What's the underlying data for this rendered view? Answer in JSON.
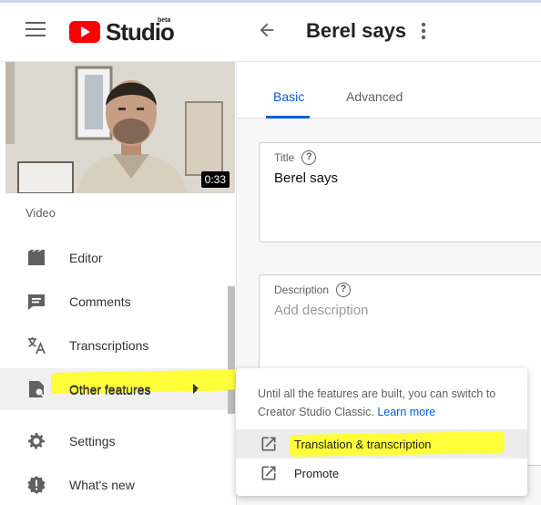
{
  "header": {
    "logo_text": "Studio",
    "logo_badge": "beta",
    "page_title": "Berel says",
    "icons": [
      "menu-icon",
      "youtube-play-icon",
      "back-arrow-icon",
      "more-vert-icon"
    ]
  },
  "sidebar": {
    "video_duration": "0:33",
    "section_label": "Video",
    "items": [
      {
        "label": "Editor",
        "icon": "film-icon"
      },
      {
        "label": "Comments",
        "icon": "comments-icon"
      },
      {
        "label": "Transcriptions",
        "icon": "translate-icon"
      },
      {
        "label": "Other features",
        "icon": "other-features-icon"
      },
      {
        "label": "Settings",
        "icon": "gear-icon"
      },
      {
        "label": "What's new",
        "icon": "whats-new-icon"
      }
    ]
  },
  "tabs": [
    {
      "label": "Basic"
    },
    {
      "label": "Advanced"
    }
  ],
  "form": {
    "title_label": "Title",
    "title_value": "Berel says",
    "description_label": "Description",
    "description_placeholder": "Add description"
  },
  "popup": {
    "text": "Until all the features are built, you can switch to Creator Studio Classic.",
    "link": "Learn more",
    "items": [
      {
        "label": "Translation & transcription",
        "icon": "open-in-new-icon"
      },
      {
        "label": "Promote",
        "icon": "open-in-new-icon"
      }
    ]
  },
  "colors": {
    "accent": "#065fd4",
    "youtube_red": "#ff0000",
    "highlight": "#ffff3a"
  }
}
